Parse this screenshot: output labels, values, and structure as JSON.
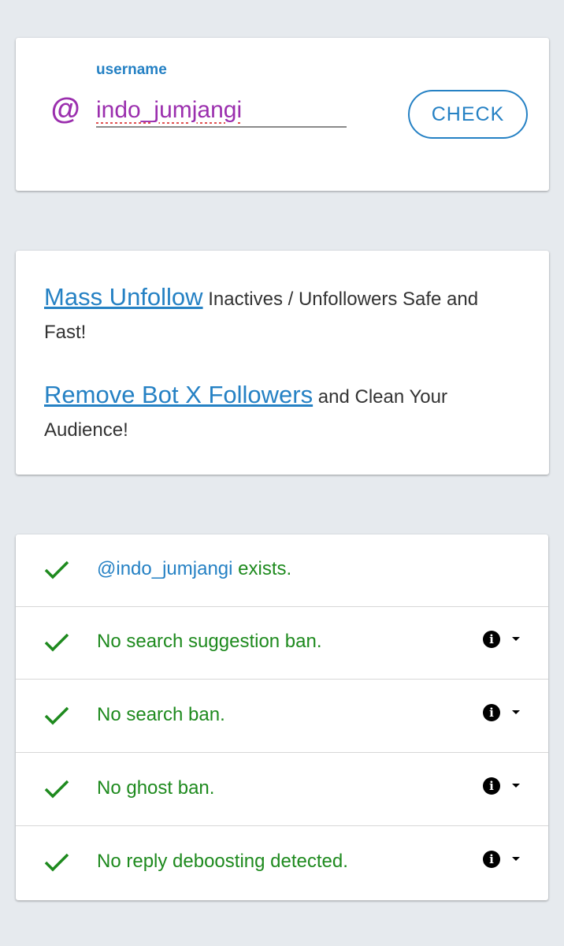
{
  "search": {
    "at_symbol": "@",
    "label": "username",
    "value": "indo_jumjangi",
    "button_label": "CHECK"
  },
  "promos": [
    {
      "link_text": "Mass Unfollow",
      "rest_text": " Inactives / Unfollowers Safe and Fast!"
    },
    {
      "link_text": "Remove Bot X Followers",
      "rest_text": " and Clean Your Audience!"
    }
  ],
  "results": {
    "exists": {
      "handle": "@indo_jumjangi",
      "suffix": " exists."
    },
    "items": [
      {
        "text": "No search suggestion ban.",
        "info_icon": "info-icon",
        "toggle_icon": "chevron-down-icon"
      },
      {
        "text": "No search ban.",
        "info_icon": "info-icon",
        "toggle_icon": "chevron-down-icon"
      },
      {
        "text": "No ghost ban.",
        "info_icon": "info-icon",
        "toggle_icon": "chevron-down-icon"
      },
      {
        "text": "No reply deboosting detected.",
        "info_icon": "info-icon",
        "toggle_icon": "chevron-down-icon"
      }
    ]
  },
  "colors": {
    "background": "#e6eaee",
    "accent": "#2581c4",
    "at_sign": "#9b2fae",
    "success": "#1e8a1e"
  }
}
